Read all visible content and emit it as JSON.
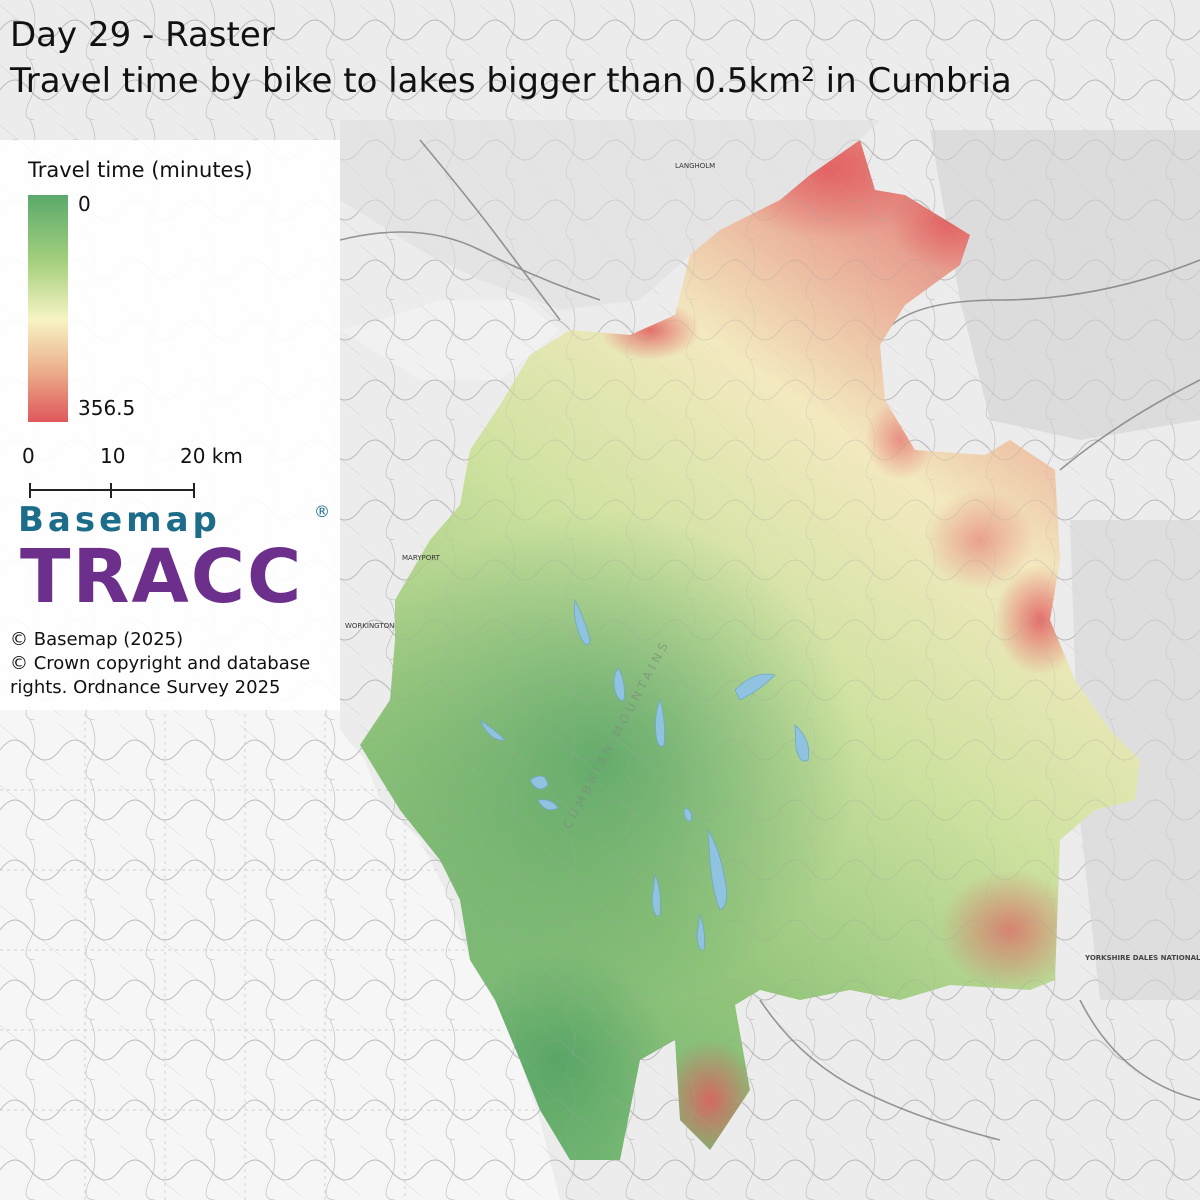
{
  "title": {
    "line1": "Day 29 - Raster",
    "line2": "Travel time by bike to lakes bigger than 0.5km² in Cumbria"
  },
  "legend": {
    "title": "Travel time (minutes)",
    "min_label": "0",
    "max_label": "356.5",
    "min_value": 0,
    "max_value": 356.5,
    "colors": [
      "#5aa96b",
      "#a6d17e",
      "#f7f4c4",
      "#ebac8a",
      "#df575b"
    ]
  },
  "scale_bar": {
    "labels": [
      "0",
      "10",
      "20 km"
    ]
  },
  "logo": {
    "top": "Basemap",
    "main": "TRACC",
    "registered": "®"
  },
  "credits": [
    "© Basemap (2025)",
    "© Crown copyright and database",
    "rights. Ordnance Survey 2025"
  ],
  "map_labels": {
    "mountains": "CUMBRIAN MOUNTAINS",
    "national_park": "YORKSHIRE DALES NATIONAL PARK",
    "towns": [
      "LANGHOLM",
      "WORKINGTON",
      "MARYPORT"
    ]
  },
  "colors": {
    "lake": "#8fc3e0",
    "basemap_background": "#e9e9e9",
    "sea": "#f3f3f3"
  }
}
